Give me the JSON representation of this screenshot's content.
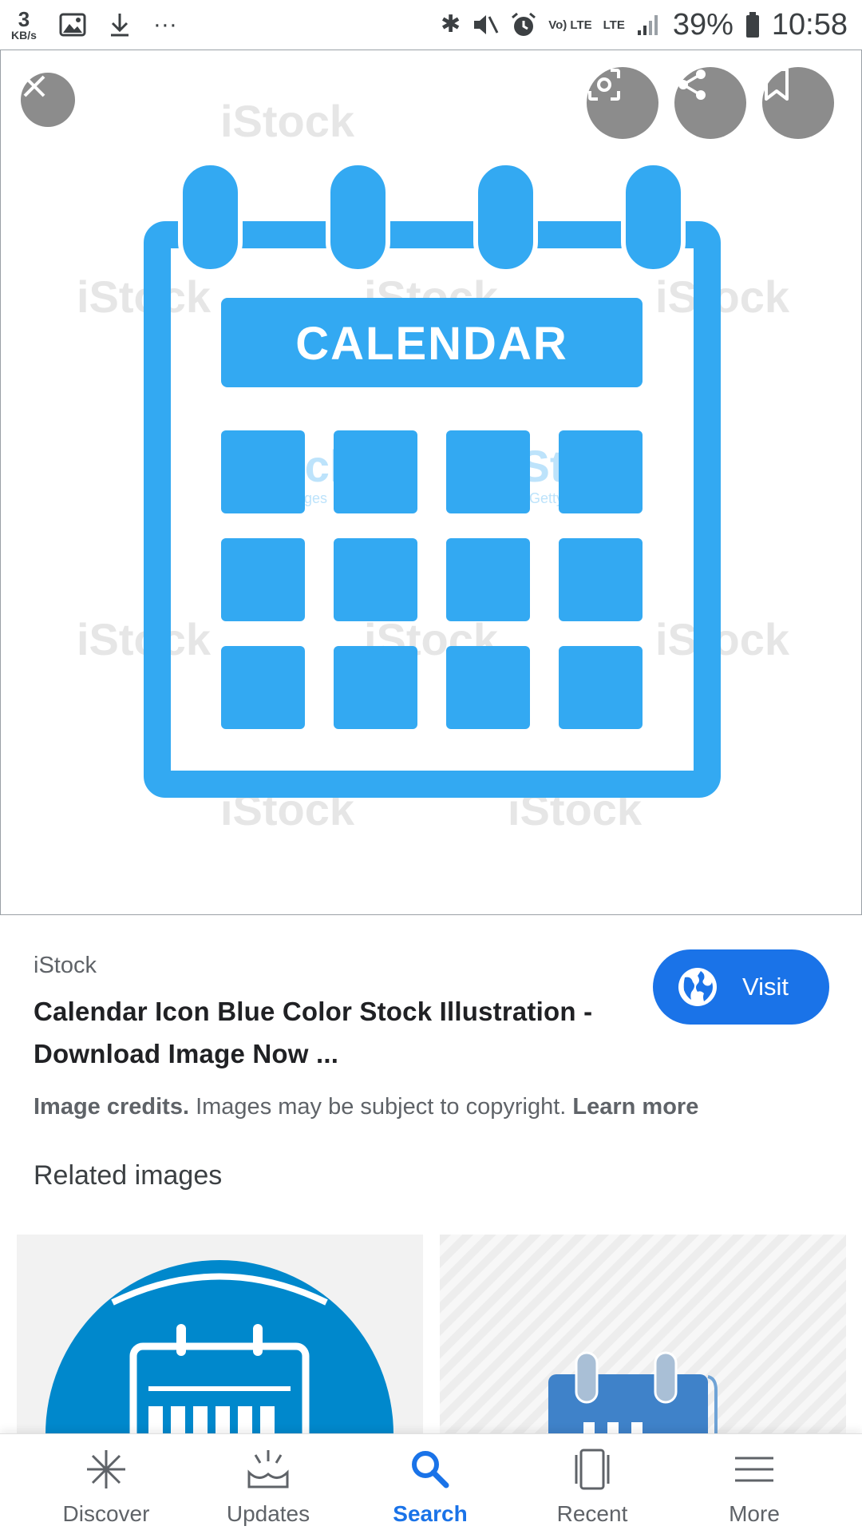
{
  "status_bar": {
    "net_speed": "3",
    "net_unit": "KB/s",
    "overflow": "···",
    "volte_label": "Vo) LTE",
    "lte_label": "LTE",
    "battery": "39%",
    "time": "10:58",
    "icons": [
      "image-icon",
      "download-icon",
      "bluetooth-icon",
      "mute-icon",
      "alarm-icon",
      "signal-icon",
      "battery-icon"
    ]
  },
  "viewer": {
    "image_text": "CALENDAR",
    "watermark_brand": "iStock",
    "watermark_sub": "by Getty Images",
    "accent_color": "#33a9f2",
    "actions": [
      "close-icon",
      "lens-icon",
      "share-icon",
      "bookmark-icon"
    ]
  },
  "result": {
    "source": "iStock",
    "title": "Calendar Icon Blue Color Stock Illustration - Download Image Now ...",
    "visit_label": "Visit"
  },
  "credits": {
    "bold_label": "Image credits.",
    "text": " Images may be subject to copyright. ",
    "link": "Learn more"
  },
  "related": {
    "heading": "Related images"
  },
  "bottom_nav": {
    "active": "Search",
    "active_color": "#1a73e8",
    "items": [
      {
        "label": "Discover",
        "icon": "asterisk-icon"
      },
      {
        "label": "Updates",
        "icon": "updates-icon"
      },
      {
        "label": "Search",
        "icon": "search-icon"
      },
      {
        "label": "Recent",
        "icon": "recent-icon"
      },
      {
        "label": "More",
        "icon": "menu-icon"
      }
    ]
  }
}
